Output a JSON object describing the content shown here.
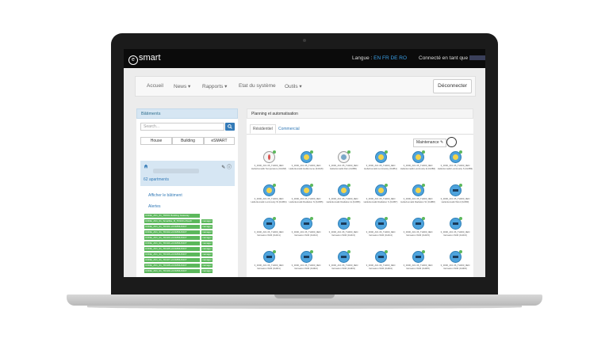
{
  "app": {
    "logo_text": "smart",
    "logo_mark": "e"
  },
  "topbar": {
    "language_label": "Langue :",
    "languages": [
      "EN",
      "FR",
      "DE",
      "RO"
    ],
    "connected_label": "Connecté en tant que"
  },
  "nav": {
    "items": [
      "Accueil",
      "News ▾",
      "Rapports ▾",
      "Etat du système",
      "Outils ▾"
    ],
    "logout_label": "Déconnecter"
  },
  "left_panel": {
    "title": "Bâtiments",
    "search_placeholder": "Search...",
    "segments": [
      "House",
      "Building",
      "eSMART"
    ],
    "building": {
      "apartments": "62 apartments"
    },
    "links": [
      "Afficher le bâtiment",
      "Alertes"
    ],
    "tags": [
      [
        "CODE_AV1_01_TR001 Building Gateway",
        ""
      ],
      [
        "CODE_AV1_01_Smartlite_B_TR100 eTouch",
        "manager"
      ],
      [
        "CODE_AV1_01_TR101 eCOMMUNICT",
        "manager"
      ],
      [
        "CODE_AV1_01_TR102 eCOMMUNICT",
        "manager"
      ],
      [
        "CODE_AV1_01_TR103 eCOMMUNICT",
        "manager"
      ],
      [
        "CODE_AV1_01_TR104 eCOMMUNICT",
        "manager"
      ],
      [
        "CODE_AV1_01_TR105 eCOMMUNICT",
        "manager"
      ],
      [
        "CODE_AV1_01_TR106 eCOMMUNICT",
        "manager"
      ],
      [
        "CODE_AV1_01_TR107 eCOMMUNICT",
        "manager"
      ],
      [
        "CODE_AV1_01_TR108 eCOMMUNICT",
        "manager"
      ],
      [
        "CODE_AV1_01_TR109 eCOMMUNICT",
        "manager"
      ]
    ]
  },
  "right_panel": {
    "title": "Planning et automatisation",
    "tabs": [
      "Résidentiel",
      "Commercial"
    ],
    "maintenance_label": "Maintenance ✎",
    "devices": [
      {
        "label": "3_0000_AV1 05_TH000_0EN Hellerkomatik Temperature (0x0A8)",
        "icon": "thermometer"
      },
      {
        "label": "3_0000_AV1 05_TH000_0EN Hellerkomatik Helikomene (0x0A8)",
        "icon": "sun"
      },
      {
        "label": "3_0000_AV1 05_TH000_0EN Hellerkomatik Rain (0x0B0)",
        "icon": "rain"
      },
      {
        "label": "3_0000_AV1 05_TH000_0EN Hellerkomatik Luminosity (0x0B1)",
        "icon": "sun"
      },
      {
        "label": "3_0000_AV1 05_TH000_0EN Hellerkomatik Luminosity E (0x0B2)",
        "icon": "sun"
      },
      {
        "label": "3_0000_AV1 05_TH000_0EN Hellerkomatik Luminosity S (0x0B3)",
        "icon": "sun"
      },
      {
        "label": "3_0000_AV1 05_TH000_0EN Hellerkomatik Luminosity W (0x0B4)",
        "icon": "sun"
      },
      {
        "label": "3_0000_AV1 05_TH000_0EN Hellerkomatik Radiation N (0x0B5)",
        "icon": "sun"
      },
      {
        "label": "3_0000_AV1 05_TH000_0EN Hellerkomatik Radiation E (0x0B6)",
        "icon": "sun"
      },
      {
        "label": "3_0000_AV1 05_TH000_0EN Hellerkomatik Radiation S (0x0B7)",
        "icon": "sun"
      },
      {
        "label": "3_0000_AV1 05_TH000_0EN Hellerkomatik Radiation W (0x0B8)",
        "icon": "sun"
      },
      {
        "label": "3_0000_AV1 05_TH000_0EN Hellerkomatik Wind (0x0B9)",
        "icon": "blind"
      },
      {
        "label": "3_0000_AV1 06_TH000_0EN Velmatron W06 (0x0C1)",
        "icon": "blind"
      },
      {
        "label": "3_0000_AV1 06_TH000_0EN Velmatron W06 (0x0C2)",
        "icon": "blind"
      },
      {
        "label": "3_0000_AV1 06_TH000_0EN Velmatron W06 (0x0C3)",
        "icon": "blind"
      },
      {
        "label": "3_0000_AV1 06_TH000_0EN Velmatron W06 (0x0C4)",
        "icon": "blind"
      },
      {
        "label": "3_0000_AV1 06_TH000_0EN Velmatron W06 (0x0C5)",
        "icon": "blind"
      },
      {
        "label": "3_0000_AV1 06_TH000_0EN Velmatron W06 (0x0C6)",
        "icon": "blind"
      },
      {
        "label": "3_0000_AV1 06_TH000_0EN Velmatron W06 (0x0D1)",
        "icon": "blind"
      },
      {
        "label": "3_0000_AV1 06_TH000_0EN Velmatron W06 (0x0D2)",
        "icon": "blind"
      },
      {
        "label": "3_0000_AV1 06_TH000_0EN Velmatron W06 (0x0D3)",
        "icon": "blind"
      },
      {
        "label": "3_0000_AV1 06_TH000_0EN Velmatron W06 (0x0D4)",
        "icon": "blind"
      },
      {
        "label": "3_0000_AV1 06_TH000_0EN Velmatron W06 (0x0D5)",
        "icon": "blind"
      },
      {
        "label": "3_0000_AV1 06_TH000_0EN Velmatron W06 (0x0D6)",
        "icon": "blind"
      }
    ]
  },
  "colors": {
    "accent": "#337ab7",
    "device_blue": "#4da3dd",
    "tag_green": "#5cb85c",
    "panel_blue": "#d6e6f3"
  }
}
